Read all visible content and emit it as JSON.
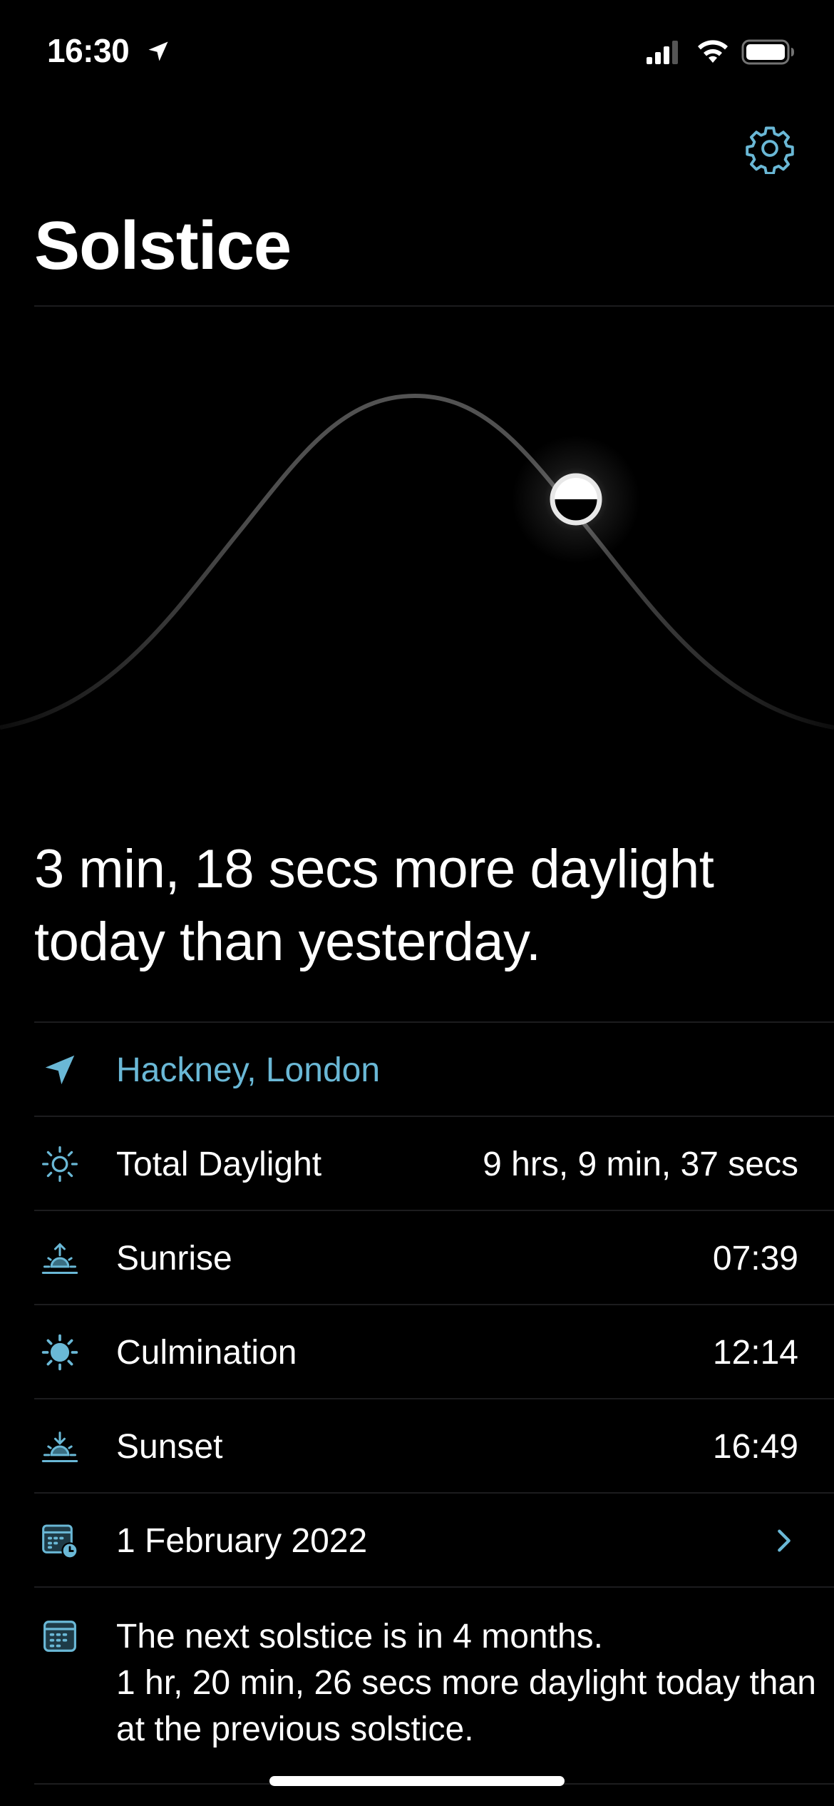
{
  "status_bar": {
    "time": "16:30",
    "icons": [
      "location-arrow-icon",
      "signal-icon",
      "wifi-icon",
      "battery-icon"
    ]
  },
  "header": {
    "title": "Solstice",
    "settings_icon": "gear-icon"
  },
  "sun_position": {
    "icon": "sun-marker-icon"
  },
  "headline": "3 min, 18 secs more daylight today than yesterday.",
  "location": {
    "icon": "location-arrow-icon",
    "label": "Hackney, London"
  },
  "rows": [
    {
      "icon": "sun-icon",
      "label": "Total Daylight",
      "value": "9 hrs, 9 min, 37 secs"
    },
    {
      "icon": "sunrise-icon",
      "label": "Sunrise",
      "value": "07:39"
    },
    {
      "icon": "sun-filled-icon",
      "label": "Culmination",
      "value": "12:14"
    },
    {
      "icon": "sunset-icon",
      "label": "Sunset",
      "value": "16:49"
    }
  ],
  "date_row": {
    "icon": "calendar-clock-icon",
    "label": "1 February 2022",
    "chevron_icon": "chevron-right-icon"
  },
  "solstice_note": {
    "icon": "calendar-icon",
    "line1": "The next solstice is in 4 months.",
    "line2": "1 hr, 20 min, 26 secs more daylight today than at the previous solstice."
  },
  "colors": {
    "accent": "#6ab8d6",
    "background": "#000000",
    "divider": "#1c1c1e"
  }
}
